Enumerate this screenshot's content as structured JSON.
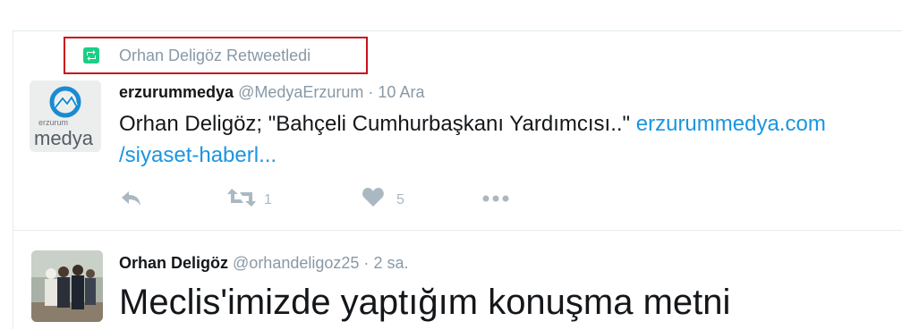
{
  "retweet_context": {
    "label": "Orhan Deligöz Retweetledi",
    "icon": "retweet-icon",
    "highlight_color": "#c8121a"
  },
  "tweets": [
    {
      "name": "erzurummedya",
      "handle": "@MedyaErzurum",
      "separator": "·",
      "time": "10 Ara",
      "text": "Orhan Deligöz; \"Bahçeli Cumhurbaşkanı Yardımcısı..\"",
      "link_part1": "erzurummedya.com",
      "link_part2": "/siyaset-haberl...",
      "avatar": {
        "top_text": "erzurum",
        "bottom_text": "medya",
        "icon": "erzurummedya-logo-icon"
      },
      "actions": {
        "reply_icon": "reply-icon",
        "retweet_icon": "retweet-icon",
        "retweet_count": "1",
        "like_icon": "heart-icon",
        "like_count": "5",
        "more_icon": "more-icon"
      }
    },
    {
      "name": "Orhan Deligöz",
      "handle": "@orhandeligoz25",
      "separator": "·",
      "time": "2 sa.",
      "text": "Meclis'imizde yaptığım konuşma metni",
      "avatar": {
        "icon": "profile-photo"
      }
    }
  ],
  "colors": {
    "link": "#1b95e0",
    "muted": "#8899a6",
    "action": "#aab8c2",
    "retweet_green": "#19cf86"
  }
}
